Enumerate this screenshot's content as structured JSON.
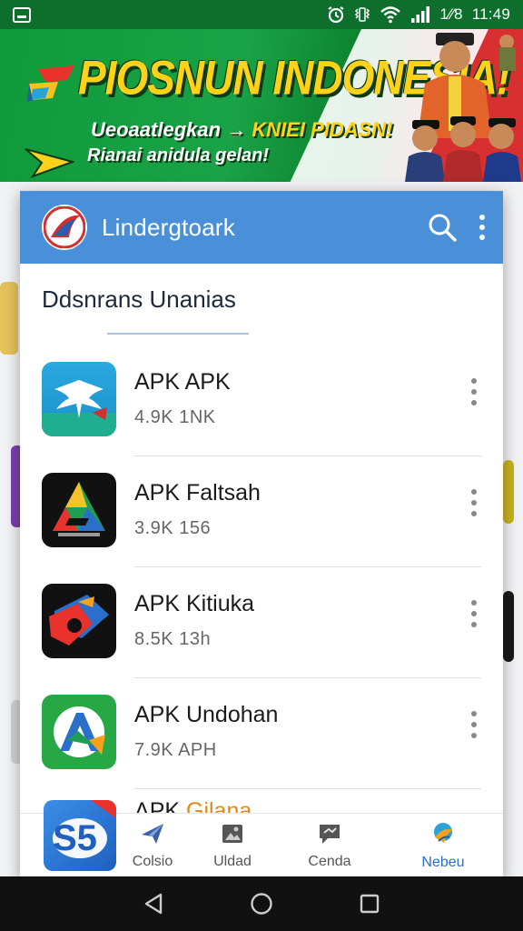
{
  "status_bar": {
    "battery_text": "1⁄⁄8",
    "time": "11:49"
  },
  "banner": {
    "title": "PIOSNUN INDONESIA!",
    "subtitle_line1_left": "Ueoaatlegkan",
    "subtitle_line1_arrow": "→",
    "subtitle_line1_right": "KNIEI PIDASN!",
    "subtitle_line2": "Rianai anidula gelan!"
  },
  "app_bar": {
    "title": "Lindergtoark",
    "logo": "app-logo-icon",
    "search_icon": "search-icon",
    "more_icon": "more-vertical-icon",
    "color": "#4a90d9"
  },
  "section": {
    "title": "Ddsnrans Unanias"
  },
  "apps": [
    {
      "title": "APK APK",
      "meta": "4.9K   1NK",
      "icon": "garuda-bird-icon"
    },
    {
      "title": "APK Faltsah",
      "meta": "3.9K   156",
      "icon": "triangle-logo-icon"
    },
    {
      "title": "APK Kitiuka",
      "meta": "8.5K   13h",
      "icon": "red-blue-arrow-icon"
    },
    {
      "title": "APK Undohan",
      "meta": "7.9K   APH",
      "icon": "green-check-logo-icon"
    }
  ],
  "overlap_item": {
    "title_prefix": "ΛPK ",
    "title_suffix": "Gilana"
  },
  "floating_app": {
    "label": "S5"
  },
  "bottom_nav": [
    {
      "label": "Colsio",
      "icon": "plane-icon"
    },
    {
      "label": "Uldad",
      "icon": "image-upload-icon"
    },
    {
      "label": "Cenda",
      "icon": "chat-icon"
    },
    {
      "label": "Nebeu",
      "icon": "bird-icon"
    }
  ],
  "system_nav": {
    "back": "back-triangle-icon",
    "home": "home-circle-icon",
    "recents": "recents-square-icon"
  }
}
